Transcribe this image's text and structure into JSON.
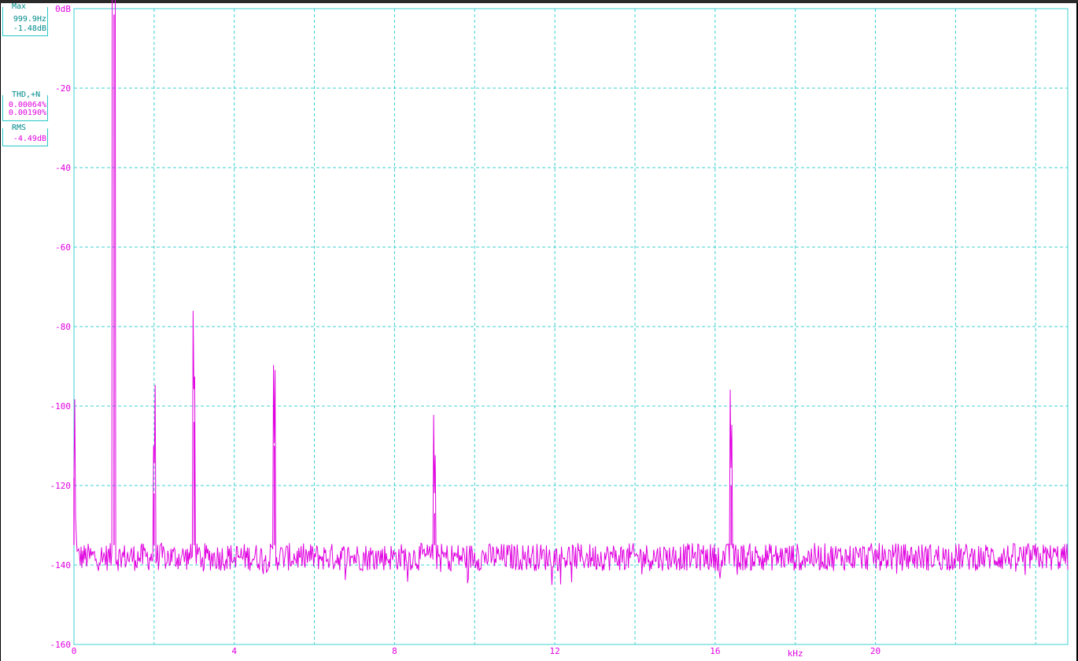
{
  "readouts": {
    "max": {
      "title": "Max",
      "freq": "999.9Hz",
      "level": "-1.48dB"
    },
    "thd": {
      "title": "THD,+N",
      "thd": "0.00064%",
      "thdn": "0.00190%"
    },
    "rms": {
      "title": "RMS",
      "value": "-4.49dB"
    }
  },
  "colors": {
    "trace": "#e000e0",
    "grid": "#40d0d0",
    "axis_text": "#e000e0",
    "frame": "#000000"
  },
  "chart_data": {
    "type": "line",
    "xlabel": "kHz",
    "ylabel": "",
    "xlim": [
      0,
      24.8
    ],
    "ylim": [
      -160,
      0
    ],
    "x_ticks": [
      0,
      4,
      8,
      12,
      16,
      20
    ],
    "x_tick_labels": [
      "0",
      "4",
      "8",
      "12",
      "16",
      "20"
    ],
    "x_grid": [
      0,
      2,
      4,
      6,
      8,
      10,
      12,
      14,
      16,
      18,
      20,
      22,
      24
    ],
    "y_ticks": [
      0,
      -20,
      -40,
      -60,
      -80,
      -100,
      -120,
      -140,
      -160
    ],
    "y_tick_labels": [
      "0dB",
      "-20",
      "-40",
      "-60",
      "-80",
      "-100",
      "-120",
      "-140",
      "-160"
    ],
    "grid": true,
    "noise_floor_db": -138,
    "series": [
      {
        "peaks": [
          {
            "x": 0.0,
            "y": -118
          },
          {
            "x": 1.0,
            "y": -1.48
          },
          {
            "x": 2.0,
            "y": -122
          },
          {
            "x": 3.0,
            "y": -104
          },
          {
            "x": 5.0,
            "y": -110
          },
          {
            "x": 9.0,
            "y": -127
          },
          {
            "x": 16.4,
            "y": -120
          }
        ]
      }
    ]
  }
}
